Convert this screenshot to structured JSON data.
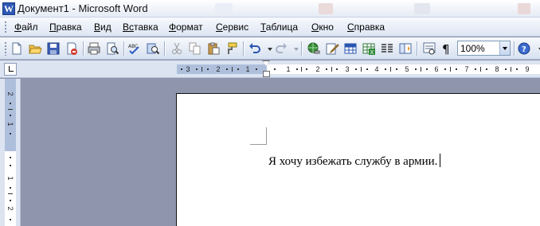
{
  "window": {
    "title": "Документ1 - Microsoft Word",
    "app_icon": "word-icon"
  },
  "menu": [
    {
      "label": "Файл",
      "u": "Ф",
      "rest": "айл"
    },
    {
      "label": "Правка",
      "u": "П",
      "rest": "равка"
    },
    {
      "label": "Вид",
      "u": "В",
      "rest": "ид"
    },
    {
      "label": "Вставка",
      "u": "Вс",
      "rest": "тавка"
    },
    {
      "label": "Формат",
      "u": "Ф",
      "rest": "ормат"
    },
    {
      "label": "Сервис",
      "u": "С",
      "rest": "ервис"
    },
    {
      "label": "Таблица",
      "u": "Т",
      "rest": "аблица"
    },
    {
      "label": "Окно",
      "u": "О",
      "rest": "кно"
    },
    {
      "label": "Справка",
      "u": "С",
      "rest": "правка"
    }
  ],
  "toolbar": {
    "icons": [
      "new-document-icon",
      "open-icon",
      "save-icon",
      "permission-icon",
      "print-icon",
      "print-preview-icon",
      "spelling-icon",
      "research-icon",
      "cut-icon",
      "copy-icon",
      "paste-icon",
      "format-painter-icon",
      "undo-icon",
      "redo-icon",
      "hyperlink-icon",
      "drawing-icon",
      "insert-table-icon",
      "insert-excel-icon",
      "columns-icon",
      "document-map-icon",
      "reading-mode-icon",
      "show-formatting-icon",
      "help-icon"
    ],
    "zoom": "100%"
  },
  "ruler": {
    "horizontal_numbers": [
      "3",
      "2",
      "1",
      "1",
      "2",
      "3",
      "4",
      "5",
      "6",
      "7",
      "8",
      "9"
    ],
    "vertical_numbers": [
      "2",
      "1",
      "1",
      "2"
    ]
  },
  "document": {
    "text": "Я хочу избежать службу в армии."
  },
  "colors": {
    "workspace": "#8f95ad",
    "ruler_margin": "#aebfdc",
    "toolbar": "#dde6f3"
  }
}
